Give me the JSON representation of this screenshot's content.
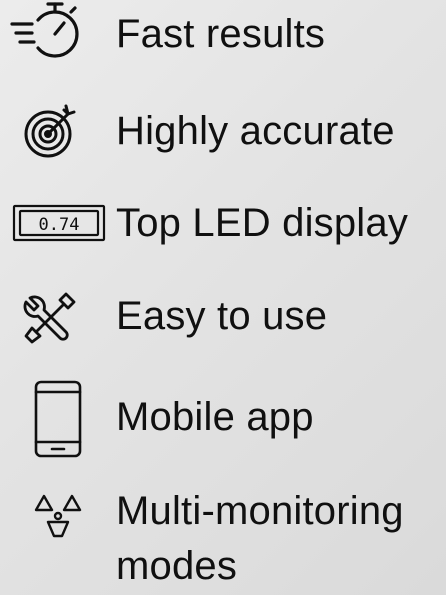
{
  "features": [
    {
      "label": "Fast results",
      "icon": "stopwatch-icon"
    },
    {
      "label": "Highly accurate",
      "icon": "target-icon"
    },
    {
      "label": "Top LED display",
      "icon": "led-display-icon",
      "icon_text": "0.74"
    },
    {
      "label": "Easy to use",
      "icon": "tools-icon"
    },
    {
      "label": "Mobile app",
      "icon": "smartphone-icon"
    },
    {
      "label": "Multi-monitoring modes",
      "icon": "radiation-icon"
    }
  ],
  "colors": {
    "text": "#101010",
    "background": "#e4e4e4"
  }
}
